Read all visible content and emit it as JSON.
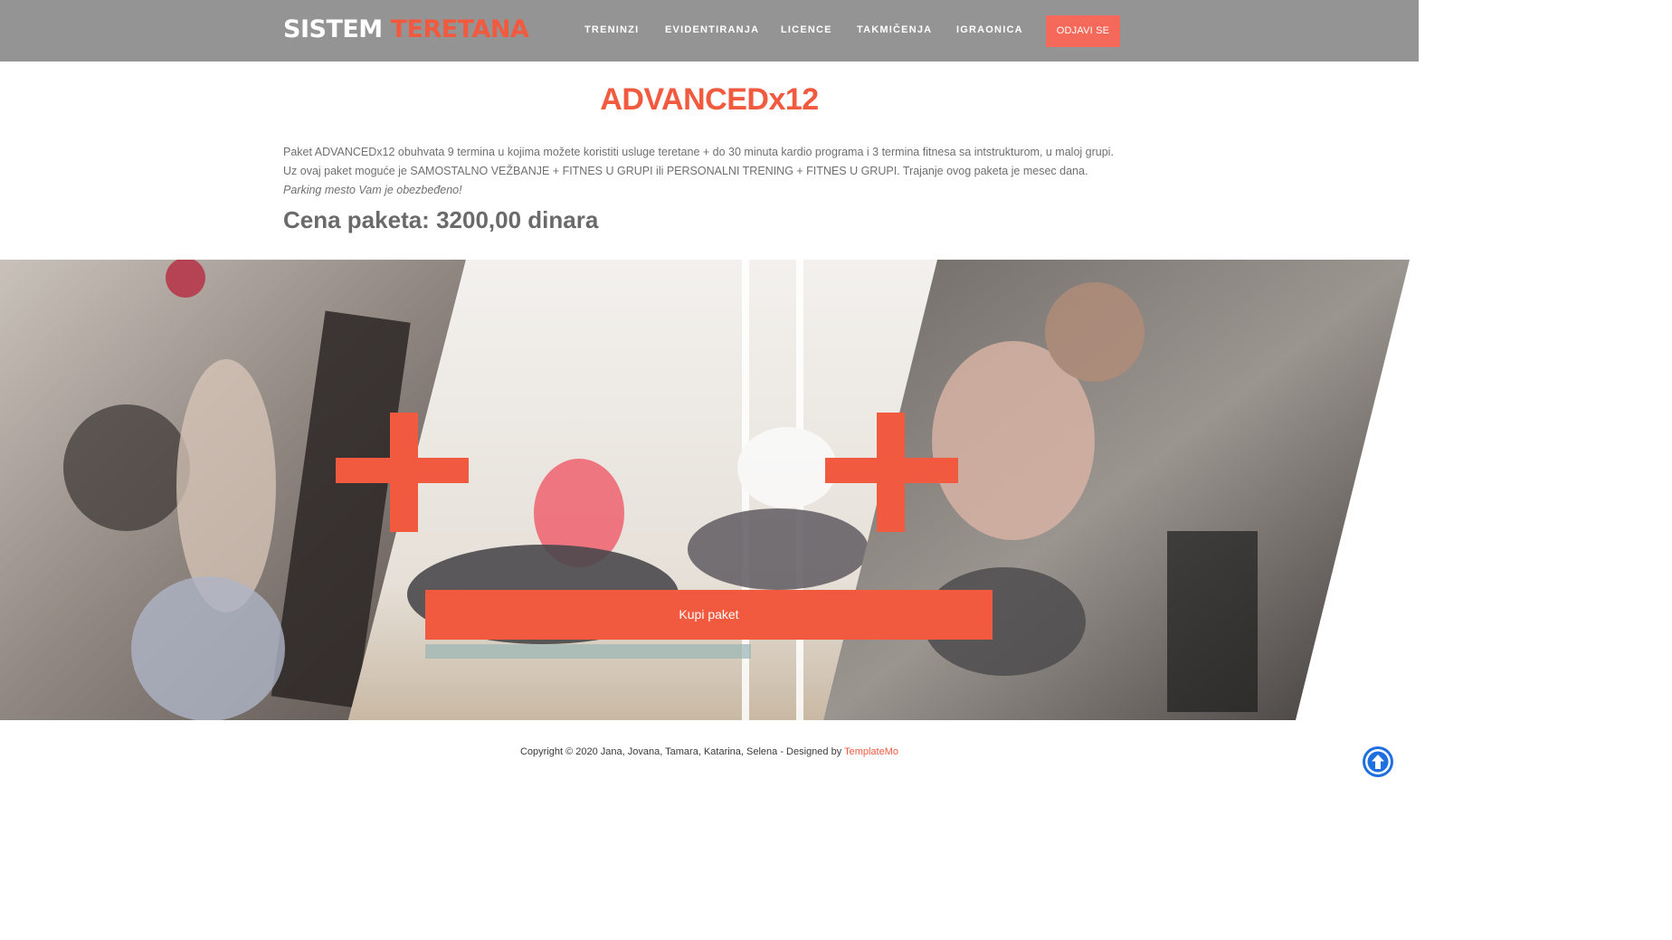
{
  "header": {
    "brand_part1": "SISTEM",
    "brand_part2": "TERETANA",
    "nav": [
      "TRENINZI",
      "EVIDENTIRANJA",
      "LICENCE",
      "TAKMIČENJA",
      "IGRAONICA"
    ],
    "logout_label": "ODJAVI SE"
  },
  "package": {
    "title": "ADVANCEDx12",
    "description": "Paket ADVANCEDx12 obuhvata 9 termina u kojima možete koristiti usluge teretane + do 30 minuta kardio programa i 3 termina fitnesa sa intstrukturom, u maloj grupi. Uz ovaj paket moguće je SAMOSTALNO VEŽBANJE + FITNES U GRUPI ili PERSONALNI TRENING + FITNES U GRUPI. Trajanje ovog paketa je mesec dana.",
    "description_italic": "Parking mesto Vam je obezbeđeno!",
    "price": "Cena paketa: 3200,00 dinara",
    "buy_label": "Kupi paket"
  },
  "footer": {
    "copyright": "Copyright © 2020 Jana, Jovana, Tamara, Katarina, Selena - Designed by",
    "designer_link": "TemplateMo"
  },
  "icons": {
    "scroll_top": "arrow-up-circle-icon",
    "plus": "plus-icon"
  },
  "colors": {
    "accent": "#f15a3f",
    "header_bg": "#949494",
    "scroll_button": "#1e6fe0"
  }
}
